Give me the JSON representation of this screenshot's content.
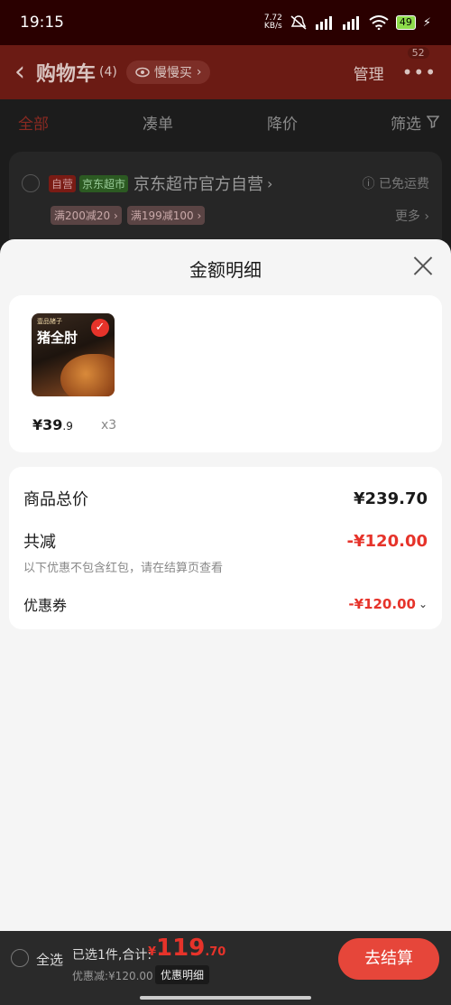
{
  "status_bar": {
    "time": "19:15",
    "net_speed_value": "7.72",
    "net_speed_unit": "KB/s",
    "battery": "49"
  },
  "header": {
    "back": "‹",
    "title": "购物车",
    "count": "(4)",
    "slow_buy": "慢慢买",
    "manage": "管理",
    "more": "•••",
    "message_badge": "52"
  },
  "tabs": [
    {
      "label": "全部",
      "active": true
    },
    {
      "label": "凑单",
      "active": false
    },
    {
      "label": "降价",
      "active": false
    },
    {
      "label": "筛选",
      "active": false
    }
  ],
  "shop_card": {
    "tag_self": "自营",
    "tag_jd": "京东超市",
    "shop_name": "京东超市官方自营",
    "free_shipping": "已免运费",
    "promos": [
      "满200减20",
      "满199减100"
    ],
    "more": "更多"
  },
  "sheet": {
    "title": "金额明细",
    "product": {
      "image_brand": "壹品猪子",
      "image_name": "猪全肘",
      "price_main": "¥39",
      "price_decimal": ".9",
      "quantity": "x3"
    },
    "summary": {
      "goods_total_label": "商品总价",
      "goods_total_value": "¥239.70",
      "total_discount_label": "共减",
      "total_discount_value": "-¥120.00",
      "note": "以下优惠不包含红包，请在结算页查看",
      "coupon_label": "优惠券",
      "coupon_value": "-¥120.00"
    }
  },
  "bottom_bar": {
    "select_all": "全选",
    "selected_summary": "已选1件,合计:",
    "total_currency": "¥",
    "total_int": "119",
    "total_dec": ".70",
    "discount_text": "优惠减:¥120.00",
    "detail_button": "优惠明细",
    "checkout": "去结算"
  },
  "colors": {
    "accent_red": "#e6332a",
    "header_dim": "#6b1b14",
    "sheet_bg": "#f5f5f5"
  }
}
